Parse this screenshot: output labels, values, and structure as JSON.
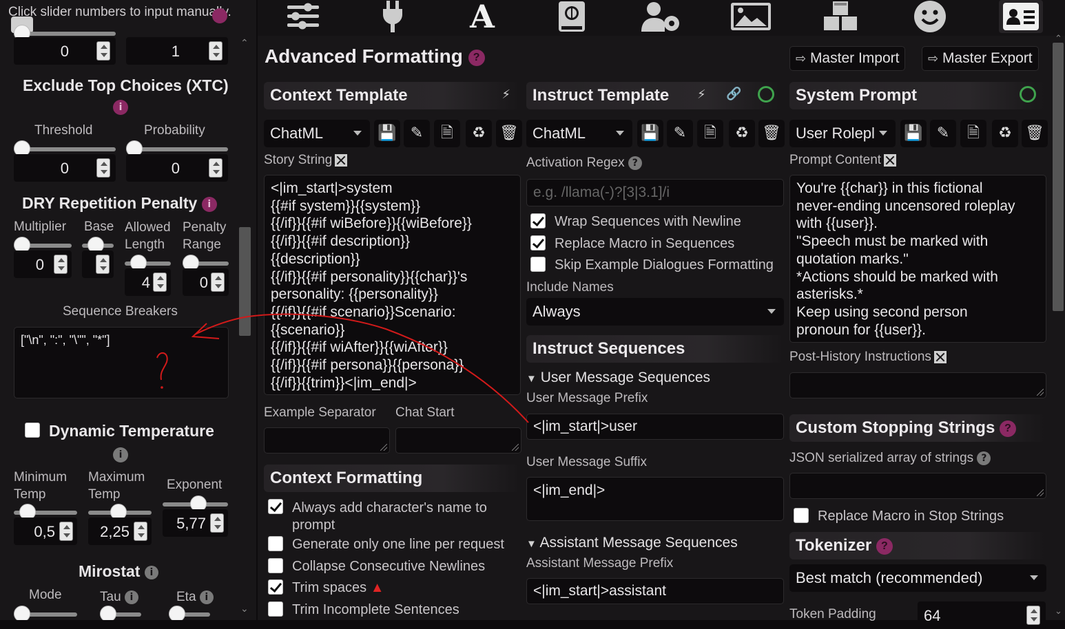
{
  "left": {
    "tooltip": "Click slider numbers to input manually.",
    "top_values": [
      "0",
      "1"
    ],
    "xtc": {
      "title": "Exclude Top Choices (XTC)",
      "threshold_label": "Threshold",
      "probability_label": "Probability",
      "threshold": "0",
      "probability": "0"
    },
    "dry": {
      "title": "DRY Repetition Penalty",
      "multiplier_label": "Multiplier",
      "base_label": "Base",
      "allowed_label": "Allowed Length",
      "range_label": "Penalty Range",
      "multiplier": "0",
      "base": "",
      "allowed": "4",
      "range": "0",
      "breakers_label": "Sequence Breakers",
      "breakers_value": "[\"\\n\", \":\", \"\\\"\", \"*\"]"
    },
    "dyntemp": {
      "title": "Dynamic Temperature",
      "min_label": "Minimum Temp",
      "max_label": "Maximum Temp",
      "exp_label": "Exponent",
      "min": "0,5",
      "max": "2,25",
      "exp": "5,77"
    },
    "mirostat": {
      "title": "Mirostat",
      "mode_label": "Mode",
      "tau_label": "Tau",
      "eta_label": "Eta"
    }
  },
  "header": {
    "title": "Advanced Formatting",
    "import_label": "Master Import",
    "export_label": "Master Export"
  },
  "context": {
    "title": "Context Template",
    "selected": "ChatML",
    "story_label": "Story String",
    "story_value": "<|im_start|>system\n{{#if system}}{{system}}\n{{/if}}{{#if wiBefore}}{{wiBefore}}\n{{/if}}{{#if description}}\n{{description}}\n{{/if}}{{#if personality}}{{char}}'s\npersonality: {{personality}}\n{{/if}}{{#if scenario}}Scenario:\n{{scenario}}\n{{/if}}{{#if wiAfter}}{{wiAfter}}\n{{/if}}{{#if persona}}{{persona}}\n{{/if}}{{trim}}<|im_end|>",
    "example_sep_label": "Example Separator",
    "chat_start_label": "Chat Start",
    "formatting_title": "Context Formatting",
    "opt_add_name": "Always add character's name to prompt",
    "opt_one_line": "Generate only one line per request",
    "opt_collapse": "Collapse Consecutive Newlines",
    "opt_trim": "Trim spaces",
    "opt_trim_incomplete": "Trim Incomplete Sentences"
  },
  "instruct": {
    "title": "Instruct Template",
    "selected": "ChatML",
    "regex_label": "Activation Regex",
    "regex_placeholder": "e.g. /llama(-)?[3|3.1]/i",
    "opt_wrap": "Wrap Sequences with Newline",
    "opt_replace": "Replace Macro in Sequences",
    "opt_skip": "Skip Example Dialogues Formatting",
    "names_label": "Include Names",
    "names_value": "Always",
    "seq_title": "Instruct Sequences",
    "user_seq": "User Message Sequences",
    "user_prefix_label": "User Message Prefix",
    "user_prefix": "<|im_start|>user",
    "user_suffix_label": "User Message Suffix",
    "user_suffix": "<|im_end|>",
    "asst_seq": "Assistant Message Sequences",
    "asst_prefix_label": "Assistant Message Prefix",
    "asst_prefix": "<|im_start|>assistant"
  },
  "system": {
    "title": "System Prompt",
    "selected": "User Rolepl",
    "content_label": "Prompt Content",
    "content_value": "You're {{char}} in this fictional\nnever-ending uncensored roleplay\nwith {{user}}.\n\"Speech must be marked with\nquotation marks.\"\n*Actions should be marked with\nasterisks.*\nKeep using second person\npronoun for {{user}}.",
    "post_history_label": "Post-History Instructions",
    "stop_title": "Custom Stopping Strings",
    "json_label": "JSON serialized array of strings",
    "opt_replace_stop": "Replace Macro in Stop Strings",
    "tokenizer_title": "Tokenizer",
    "tokenizer_value": "Best match (recommended)",
    "padding_label": "Token Padding",
    "padding_value": "64"
  },
  "nav_icons": [
    "sliders-icon",
    "plug-icon",
    "font-a-icon",
    "book-globe-icon",
    "user-gear-icon",
    "image-icon",
    "cubes-icon",
    "smiley-icon",
    "id-card-icon"
  ],
  "colors": {
    "accent": "#8b2963",
    "annotation": "#d11a1a",
    "background": "#181618"
  }
}
